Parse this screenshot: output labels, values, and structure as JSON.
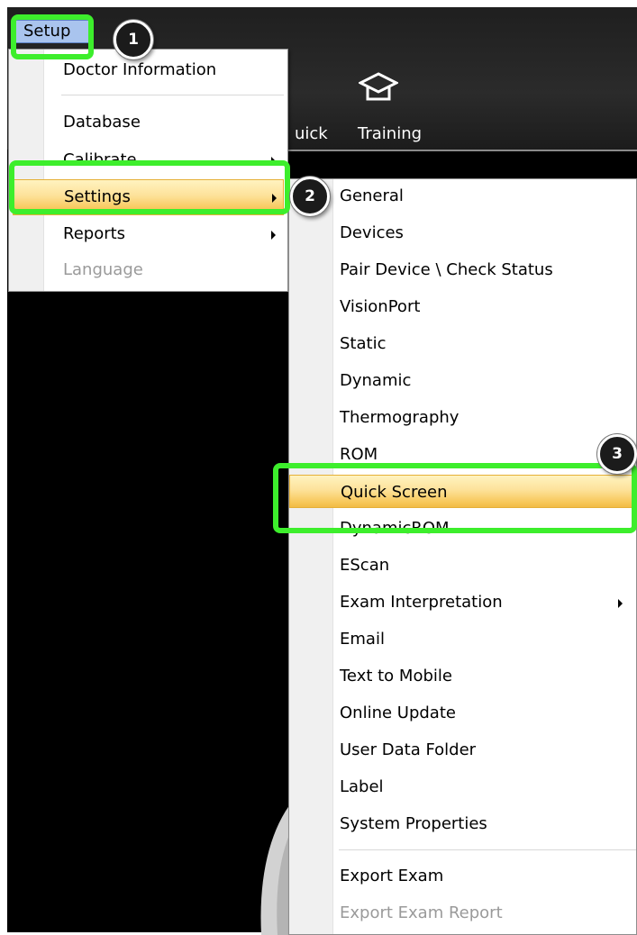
{
  "menubar": {
    "setup_label": "Setup"
  },
  "toolbar": {
    "quick_label": "uick",
    "training_label": "Training"
  },
  "setup_menu": {
    "items": [
      {
        "label": "Doctor Information",
        "disabled": false,
        "submenu": false
      },
      {
        "label": "Database",
        "disabled": false,
        "submenu": false
      },
      {
        "label": "Calibrate",
        "disabled": false,
        "submenu": true
      },
      {
        "label": "Settings",
        "disabled": false,
        "submenu": true,
        "highlighted": true
      },
      {
        "label": "Reports",
        "disabled": false,
        "submenu": true
      },
      {
        "label": "Language",
        "disabled": true,
        "submenu": false
      }
    ]
  },
  "settings_menu": {
    "items": [
      {
        "label": "General"
      },
      {
        "label": "Devices"
      },
      {
        "label": "Pair Device \\ Check  Status"
      },
      {
        "label": "VisionPort"
      },
      {
        "label": "Static"
      },
      {
        "label": "Dynamic"
      },
      {
        "label": "Thermography"
      },
      {
        "label": "ROM"
      },
      {
        "label": "Quick Screen",
        "highlighted": true
      },
      {
        "label": "DynamicROM"
      },
      {
        "label": "EScan"
      },
      {
        "label": "Exam Interpretation",
        "submenu": true
      },
      {
        "label": "Email"
      },
      {
        "label": "Text to Mobile"
      },
      {
        "label": "Online Update"
      },
      {
        "label": "User Data Folder"
      },
      {
        "label": "Label"
      },
      {
        "label": "System Properties"
      },
      {
        "label": "Export Exam"
      },
      {
        "label": "Export Exam Report",
        "disabled": true
      }
    ]
  },
  "steps": [
    "1",
    "2",
    "3"
  ],
  "colors": {
    "callout": "#3dee2c",
    "highlight": "#f7c759",
    "menubar_selected": "#a9c4ee",
    "background": "#000000"
  }
}
